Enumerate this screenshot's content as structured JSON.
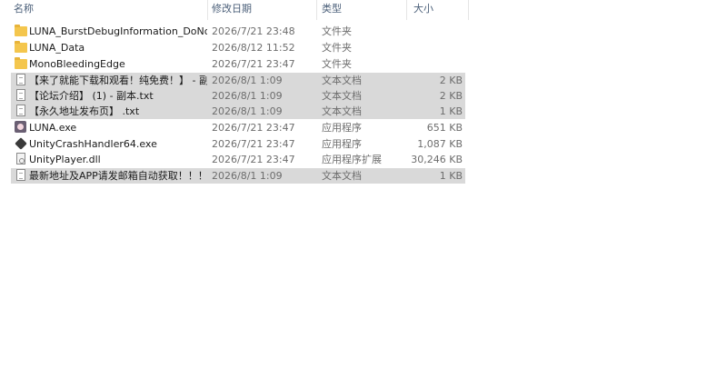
{
  "columns": {
    "name": "名称",
    "modified": "修改日期",
    "type": "类型",
    "size": "大小",
    "sort_indicator": "^"
  },
  "files": [
    {
      "name": "LUNA_BurstDebugInformation_DoNo...",
      "modified": "2026/7/21 23:48",
      "type": "文件夹",
      "size": "",
      "icon": "folder-icon",
      "selected": false
    },
    {
      "name": "LUNA_Data",
      "modified": "2026/8/12 11:52",
      "type": "文件夹",
      "size": "",
      "icon": "folder-icon",
      "selected": false
    },
    {
      "name": "MonoBleedingEdge",
      "modified": "2026/7/21 23:47",
      "type": "文件夹",
      "size": "",
      "icon": "folder-icon",
      "selected": false
    },
    {
      "name": "【来了就能下载和观看！纯免费！】 - 副...",
      "modified": "2026/8/1 1:09",
      "type": "文本文档",
      "size": "2 KB",
      "icon": "text-file-icon",
      "selected": true
    },
    {
      "name": "【论坛介绍】 (1) - 副本.txt",
      "modified": "2026/8/1 1:09",
      "type": "文本文档",
      "size": "2 KB",
      "icon": "text-file-icon",
      "selected": true
    },
    {
      "name": "【永久地址发布页】 .txt",
      "modified": "2026/8/1 1:09",
      "type": "文本文档",
      "size": "1 KB",
      "icon": "text-file-icon",
      "selected": true
    },
    {
      "name": "LUNA.exe",
      "modified": "2026/7/21 23:47",
      "type": "应用程序",
      "size": "651 KB",
      "icon": "app-icon",
      "selected": false
    },
    {
      "name": "UnityCrashHandler64.exe",
      "modified": "2026/7/21 23:47",
      "type": "应用程序",
      "size": "1,087 KB",
      "icon": "unity-icon",
      "selected": false
    },
    {
      "name": "UnityPlayer.dll",
      "modified": "2026/7/21 23:47",
      "type": "应用程序扩展",
      "size": "30,246 KB",
      "icon": "dll-file-icon",
      "selected": false
    },
    {
      "name": "最新地址及APP请发邮箱自动获取！！！...",
      "modified": "2026/8/1 1:09",
      "type": "文本文档",
      "size": "1 KB",
      "icon": "text-file-icon",
      "selected": true
    }
  ],
  "colors": {
    "selection": "#d9d9d9",
    "folder": "#f4c64d",
    "header_text": "#4c607a",
    "detail_text": "#6d6d6d"
  }
}
